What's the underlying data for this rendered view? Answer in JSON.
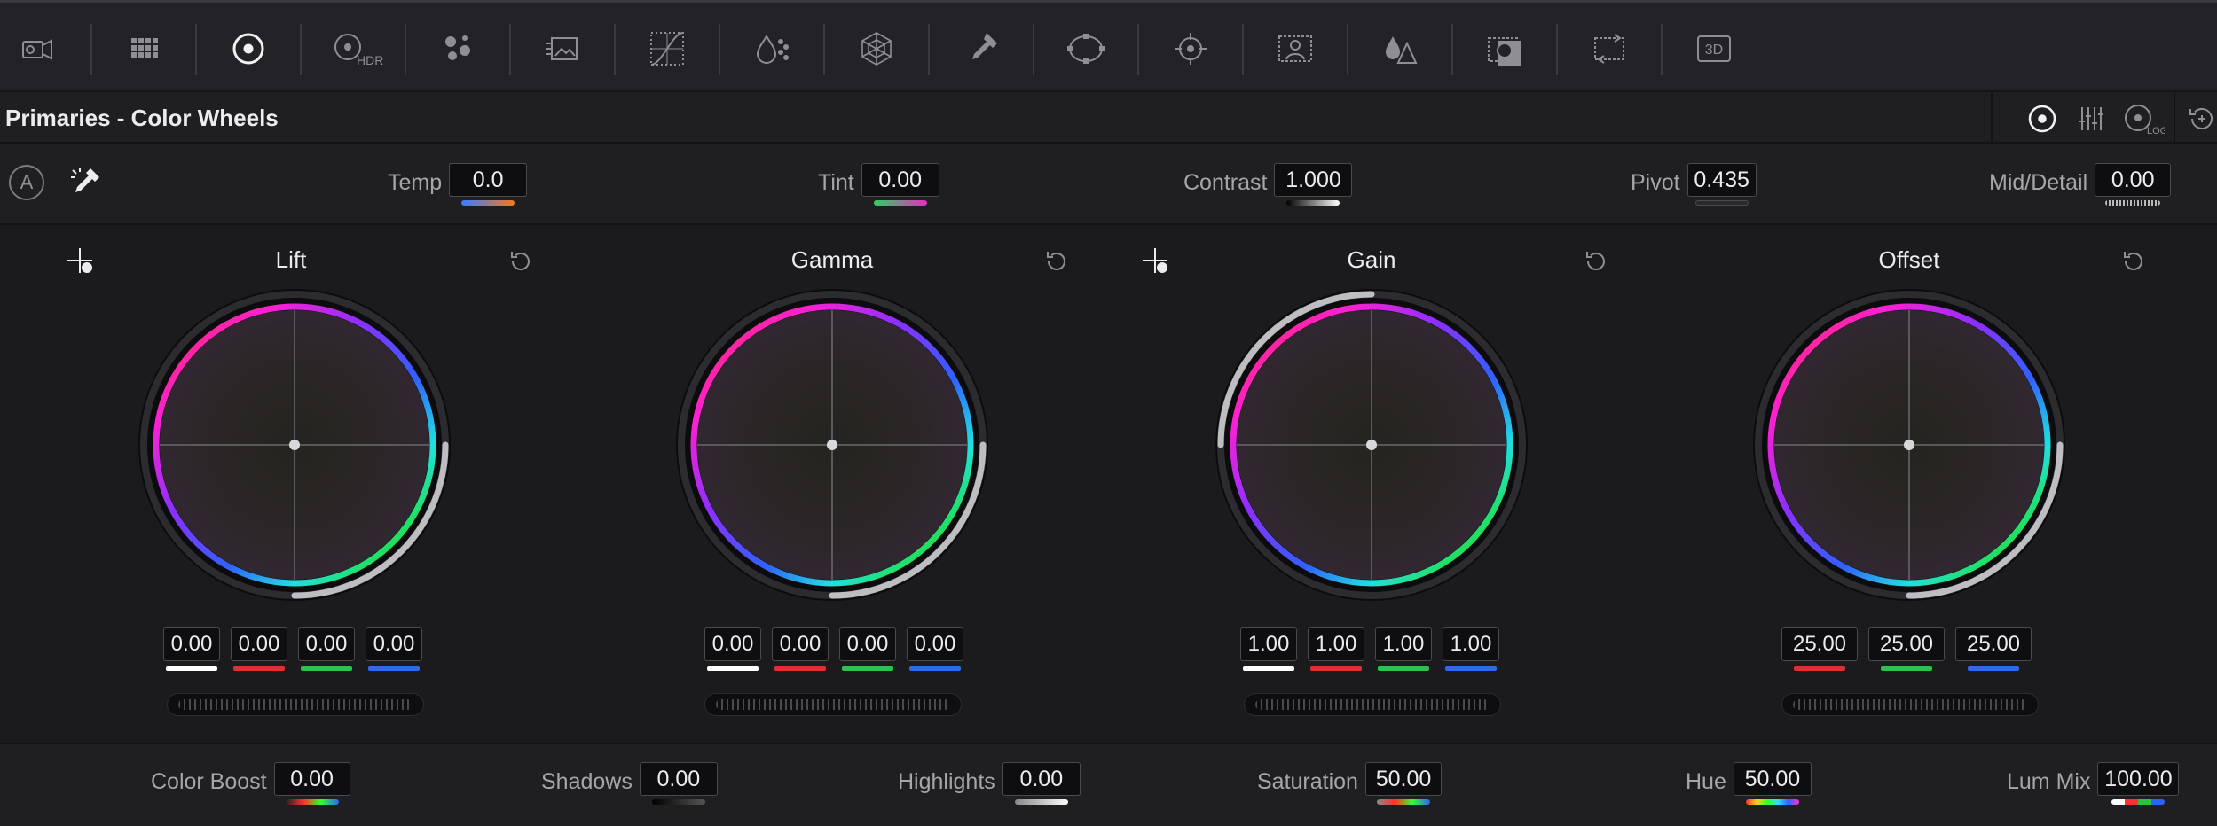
{
  "toolbar": {
    "tools": [
      {
        "icon": "camera-raw-icon"
      },
      {
        "icon": "color-match-icon"
      },
      {
        "icon": "color-wheels-icon",
        "active": true
      },
      {
        "icon": "hdr-wheels-icon",
        "label": "HDR"
      },
      {
        "icon": "rgb-mixer-icon"
      },
      {
        "icon": "motion-effects-icon"
      },
      {
        "icon": "curves-icon"
      },
      {
        "icon": "color-warper-icon"
      },
      {
        "icon": "qualifier-web-icon"
      },
      {
        "icon": "qualifier-picker-icon"
      },
      {
        "icon": "window-icon"
      },
      {
        "icon": "tracker-icon"
      },
      {
        "icon": "magic-mask-icon"
      },
      {
        "icon": "blur-icon"
      },
      {
        "icon": "key-icon"
      },
      {
        "icon": "sizing-icon"
      },
      {
        "icon": "3d-icon",
        "label": "3D"
      }
    ]
  },
  "panel": {
    "title": "Primaries - Color Wheels",
    "modes": [
      {
        "icon": "primaries-wheels-mode-icon",
        "active": true
      },
      {
        "icon": "primaries-bars-mode-icon"
      },
      {
        "icon": "log-wheels-mode-icon",
        "label": "LOG"
      },
      {
        "icon": "reset-all-icon"
      }
    ]
  },
  "adjust": {
    "auto_label": "A",
    "temp": {
      "label": "Temp",
      "value": "0.0"
    },
    "tint": {
      "label": "Tint",
      "value": "0.00"
    },
    "contrast": {
      "label": "Contrast",
      "value": "1.000"
    },
    "pivot": {
      "label": "Pivot",
      "value": "0.435"
    },
    "middetail": {
      "label": "Mid/Detail",
      "value": "0.00"
    }
  },
  "wheels": {
    "lift": {
      "title": "Lift",
      "values": [
        "0.00",
        "0.00",
        "0.00",
        "0.00"
      ]
    },
    "gamma": {
      "title": "Gamma",
      "values": [
        "0.00",
        "0.00",
        "0.00",
        "0.00"
      ]
    },
    "gain": {
      "title": "Gain",
      "values": [
        "1.00",
        "1.00",
        "1.00",
        "1.00"
      ]
    },
    "offset": {
      "title": "Offset",
      "values": [
        "25.00",
        "25.00",
        "25.00"
      ]
    }
  },
  "bottom": {
    "color_boost": {
      "label": "Color Boost",
      "value": "0.00"
    },
    "shadows": {
      "label": "Shadows",
      "value": "0.00"
    },
    "highlights": {
      "label": "Highlights",
      "value": "0.00"
    },
    "saturation": {
      "label": "Saturation",
      "value": "50.00"
    },
    "hue": {
      "label": "Hue",
      "value": "50.00"
    },
    "lum_mix": {
      "label": "Lum Mix",
      "value": "100.00"
    }
  },
  "colors": {
    "background": "#1b1b1e",
    "field": "#0e0e10",
    "text": "#ececef",
    "label": "#a6a6aa",
    "master_bar": "#ffffff",
    "red_bar": "#e03030",
    "green_bar": "#2fc24a",
    "blue_bar": "#2f6be8"
  }
}
